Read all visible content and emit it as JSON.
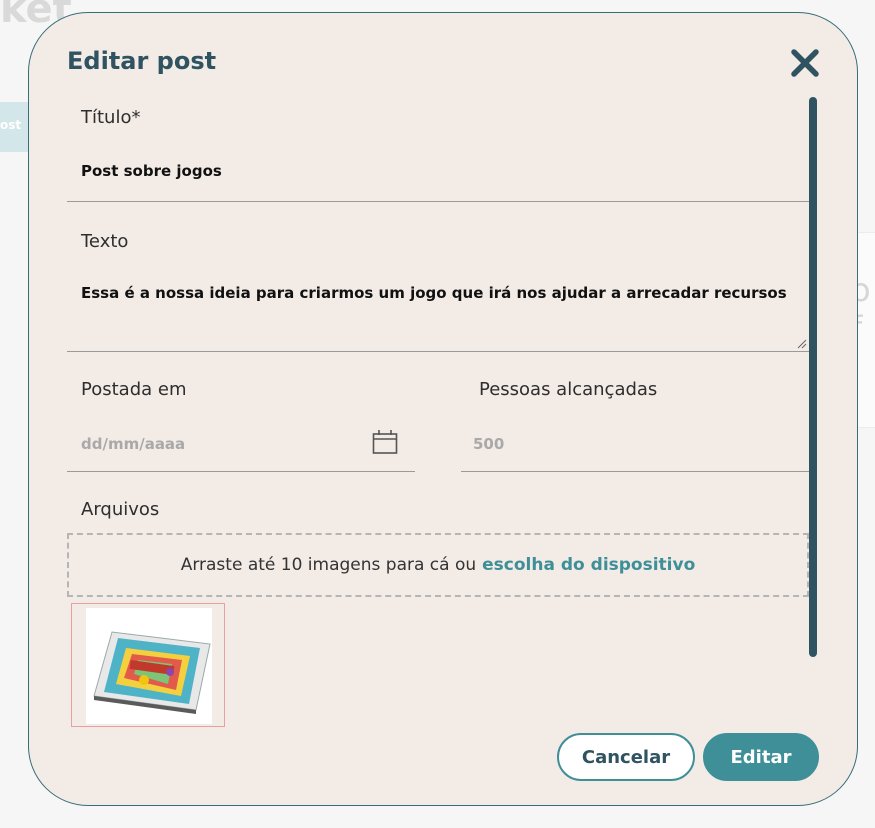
{
  "background": {
    "title_fragment": "ket",
    "chip_fragment": "ost",
    "card_fragment": "o f"
  },
  "modal": {
    "title": "Editar post",
    "close_icon": "close-icon"
  },
  "form": {
    "title": {
      "label": "Título*",
      "value": "Post sobre jogos"
    },
    "text": {
      "label": "Texto",
      "value": "Essa é a nossa ideia para criarmos um jogo que irá nos ajudar a arrecadar recursos"
    },
    "posted_at": {
      "label": "Postada em",
      "placeholder": "dd/mm/aaaa",
      "icon": "calendar-icon"
    },
    "reach": {
      "label": "Pessoas alcançadas",
      "placeholder": "500"
    },
    "files": {
      "label": "Arquivos",
      "dropzone_text": "Arraste até 10 imagens para cá ou",
      "dropzone_link": "escolha do dispositivo"
    }
  },
  "actions": {
    "cancel_label": "Cancelar",
    "submit_label": "Editar"
  },
  "colors": {
    "modal_bg": "#f3ebe6",
    "primary": "#2f5361",
    "accent": "#3f8f99"
  }
}
